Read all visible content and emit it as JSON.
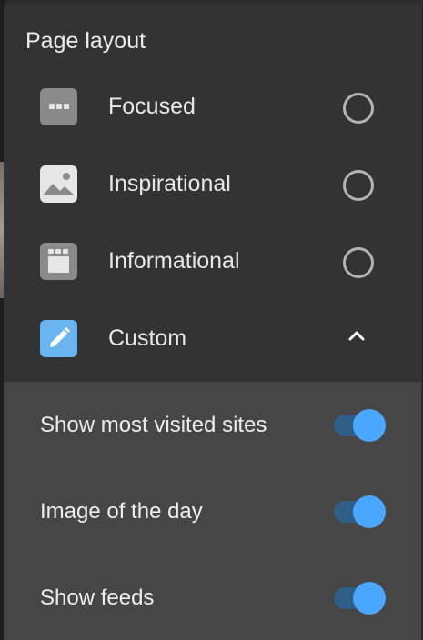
{
  "dialog": {
    "title": "Page layout",
    "options": [
      {
        "label": "Focused",
        "icon": "focused-layout-icon",
        "selected": false
      },
      {
        "label": "Inspirational",
        "icon": "image-icon",
        "selected": false
      },
      {
        "label": "Informational",
        "icon": "informational-layout-icon",
        "selected": false
      },
      {
        "label": "Custom",
        "icon": "pencil-icon",
        "expanded": true
      }
    ],
    "custom_settings": [
      {
        "label": "Show most visited sites",
        "enabled": true
      },
      {
        "label": "Image of the day",
        "enabled": true
      },
      {
        "label": "Show feeds",
        "enabled": true
      }
    ]
  },
  "colors": {
    "panel_bg": "#333333",
    "submenu_bg": "#464646",
    "accent": "#4aa6ff",
    "custom_icon_bg": "#6ab4f0",
    "icon_gray": "#8a8a8a"
  }
}
